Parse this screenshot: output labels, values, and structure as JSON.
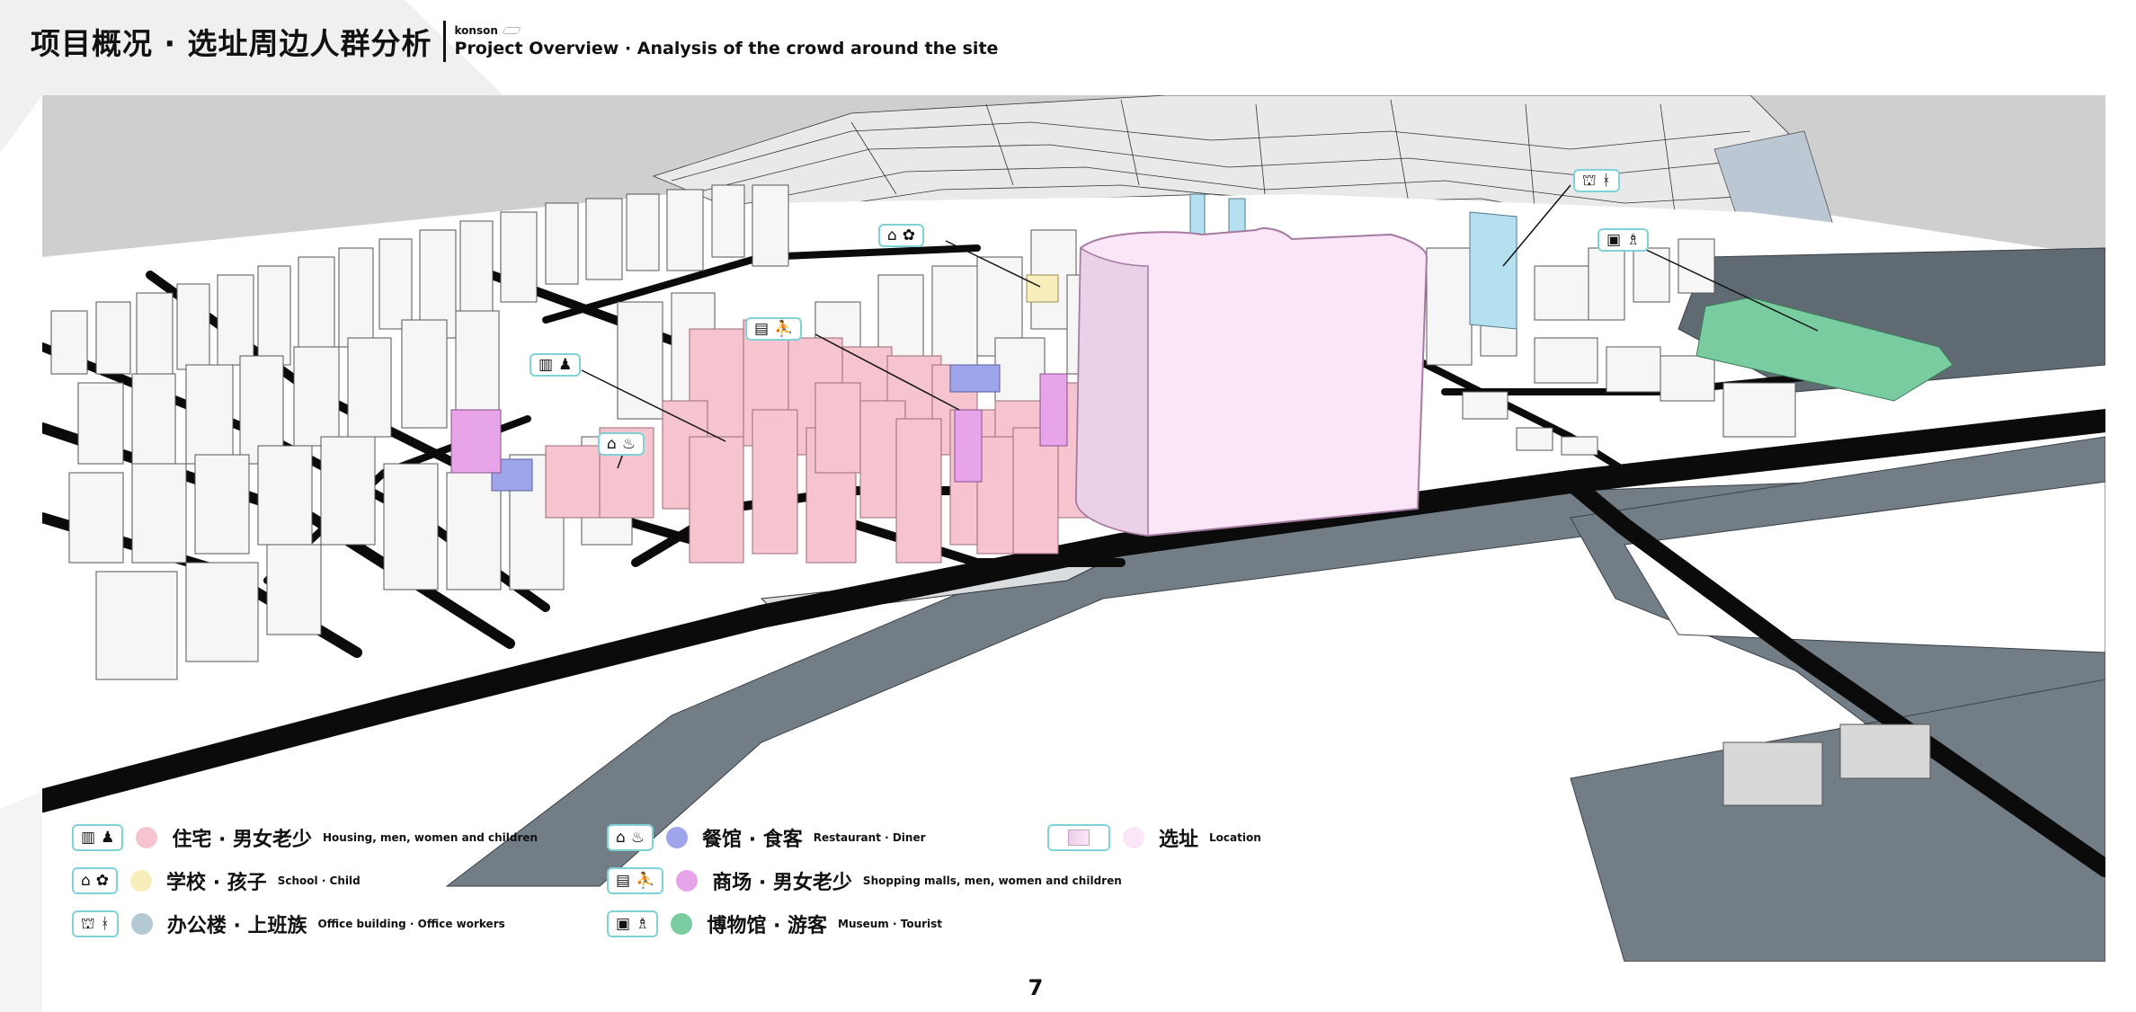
{
  "header": {
    "title_zh": "项目概况 · 选址周边人群分析",
    "brand": "konson",
    "title_en": "Project Overview · Analysis of the crowd around the site"
  },
  "legend": [
    {
      "icons": [
        "building-icon",
        "family-icon"
      ],
      "color": "#f5c4cf",
      "label_zh": "住宅 · 男女老少",
      "label_en": "Housing, men, women and children"
    },
    {
      "icons": [
        "school-icon",
        "child-icon"
      ],
      "color": "#f8eebc",
      "label_zh": "学校 · 孩子",
      "label_en": "School · Child"
    },
    {
      "icons": [
        "office-icon",
        "worker-icon"
      ],
      "color": "#b4c9d3",
      "label_zh": "办公楼 · 上班族",
      "label_en": "Office building · Office workers"
    },
    {
      "icons": [
        "restaurant-icon",
        "diner-icon"
      ],
      "color": "#9ea5ea",
      "label_zh": "餐馆 · 食客",
      "label_en": "Restaurant · Diner"
    },
    {
      "icons": [
        "mall-icon",
        "shopper-icon"
      ],
      "color": "#e8a4e8",
      "label_zh": "商场 · 男女老少",
      "label_en": "Shopping malls, men, women and children"
    },
    {
      "icons": [
        "museum-icon",
        "tourist-icon"
      ],
      "color": "#78cc9f",
      "label_zh": "博物馆 · 游客",
      "label_en": "Museum · Tourist"
    },
    {
      "icons": [
        "location-swatch-icon"
      ],
      "color": "#fbe6f8",
      "label_zh": "选址",
      "label_en": "Location"
    }
  ],
  "page_number": "7",
  "colors": {
    "housing": "#f5c4cf",
    "school": "#f8eebc",
    "office": "#b4c9d3",
    "restaurant": "#9ea5ea",
    "mall": "#e8a4e8",
    "museum": "#78cc9f",
    "site": "#fbe6f8",
    "road": "#0b0b0b",
    "plaza": "#737d86",
    "callout_border": "#7fd3d8"
  }
}
